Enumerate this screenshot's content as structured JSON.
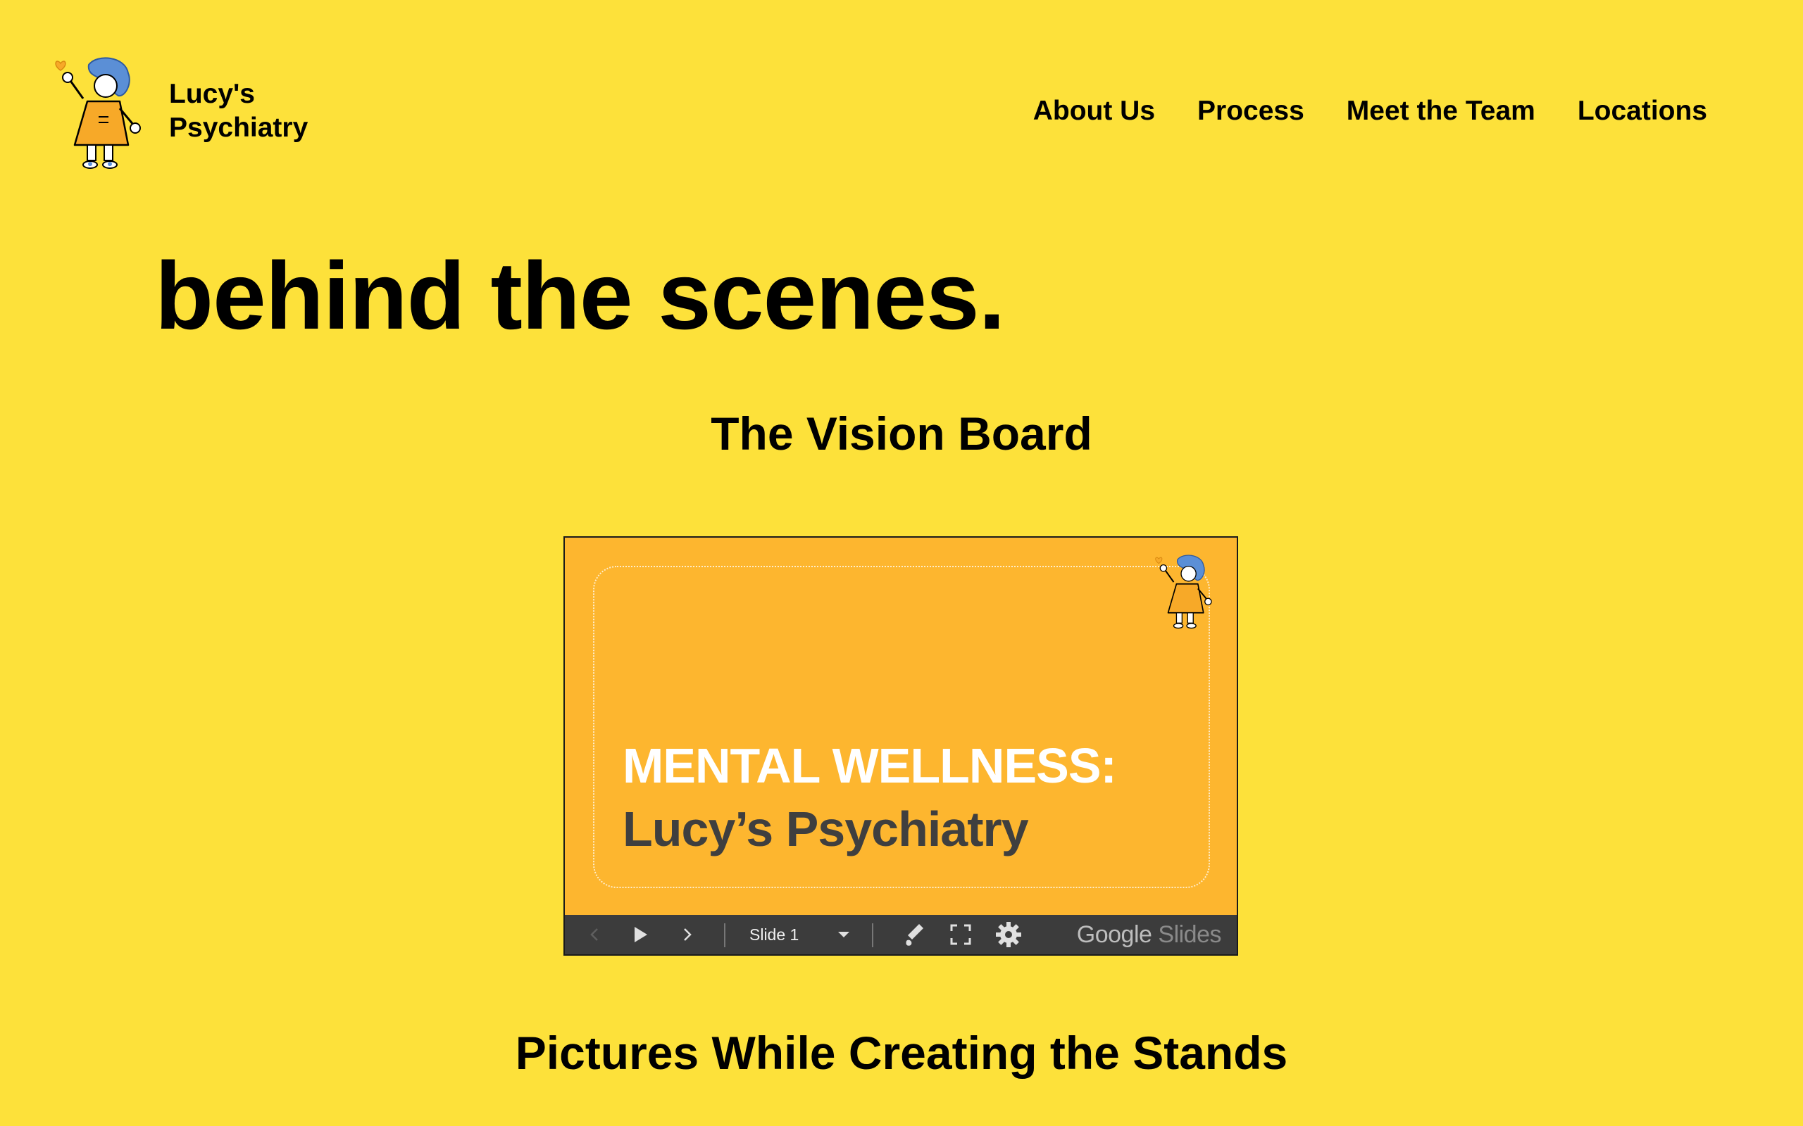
{
  "brand": {
    "name_line1": "Lucy's",
    "name_line2": "Psychiatry",
    "logo_icon": "lucy-mascot-icon"
  },
  "nav": {
    "items": [
      {
        "label": "About Us"
      },
      {
        "label": "Process"
      },
      {
        "label": "Meet the Team"
      },
      {
        "label": "Locations"
      }
    ]
  },
  "hero": {
    "title": "behind the scenes."
  },
  "vision_board": {
    "title": "The Vision Board",
    "slide": {
      "line1": "MENTAL WELLNESS:",
      "line2": "Lucy’s Psychiatry",
      "background_color": "#fdb62f"
    },
    "toolbar": {
      "slide_label": "Slide 1",
      "brand_google": "Google",
      "brand_slides": "Slides",
      "icons": [
        "chevron-left-icon",
        "play-icon",
        "chevron-right-icon",
        "dropdown-icon",
        "pen-icon",
        "fullscreen-icon",
        "gear-icon"
      ]
    }
  },
  "pictures": {
    "title": "Pictures While Creating the Stands"
  },
  "colors": {
    "page_background": "#fde13a",
    "mascot_hair": "#5b8fd6",
    "mascot_dress": "#f7a928",
    "toolbar": "#3c3c3c"
  }
}
